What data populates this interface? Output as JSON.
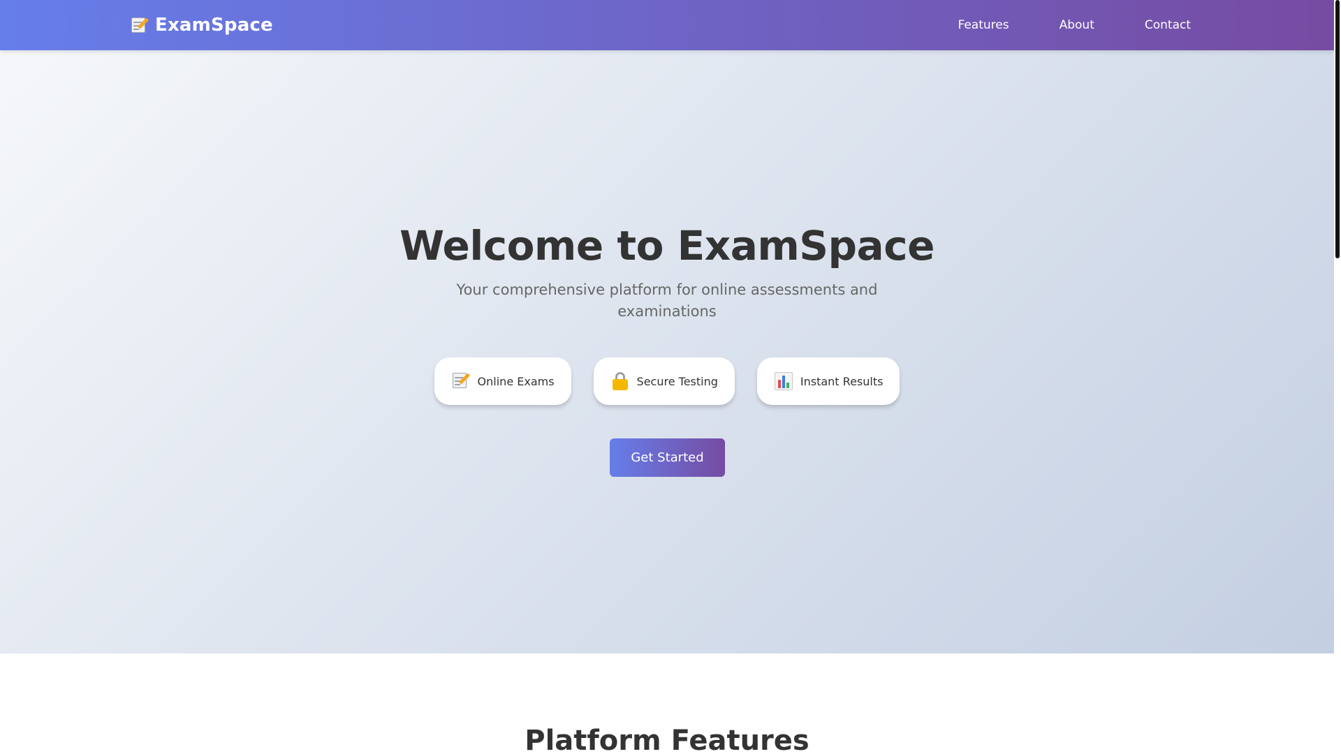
{
  "navbar": {
    "brand_name": "ExamSpace",
    "brand_icon": "memo-icon",
    "links": [
      {
        "label": "Features"
      },
      {
        "label": "About"
      },
      {
        "label": "Contact"
      }
    ],
    "gradient": [
      "#667eea",
      "#764ba2"
    ]
  },
  "hero": {
    "title": "Welcome to ExamSpace",
    "subtitle": "Your comprehensive platform for online assessments and examinations",
    "pills": [
      {
        "icon": "memo-icon",
        "label": "Online Exams"
      },
      {
        "icon": "lock-icon",
        "label": "Secure Testing"
      },
      {
        "icon": "bar-chart-icon",
        "label": "Instant Results"
      }
    ],
    "cta_label": "Get Started",
    "background": [
      "#f5f7fa",
      "#c3cfe2"
    ]
  },
  "features": {
    "title": "Platform Features"
  },
  "colors": {
    "heading": "#333333",
    "subtitle": "#666666",
    "accent_start": "#667eea",
    "accent_end": "#764ba2"
  }
}
